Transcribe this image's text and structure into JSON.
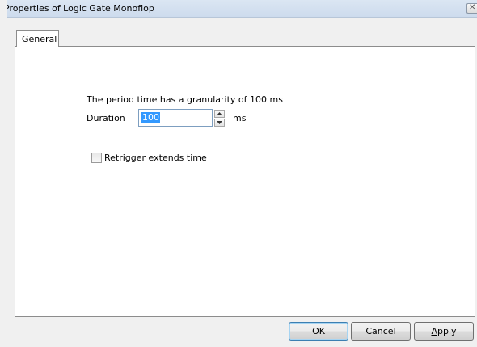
{
  "window": {
    "title": "Properties of Logic Gate Monoflop",
    "close_icon": "close-icon"
  },
  "tabs": [
    {
      "label": "General",
      "active": true
    }
  ],
  "general": {
    "info_text": "The period time has a granularity of 100 ms",
    "duration_label": "Duration",
    "duration_value": "100",
    "duration_unit": "ms",
    "retrigger_label": "Retrigger extends time",
    "retrigger_checked": false
  },
  "buttons": {
    "ok": "OK",
    "cancel": "Cancel",
    "apply_mnemonic": "A",
    "apply_rest": "pply"
  },
  "colors": {
    "selection": "#3399ff",
    "ok_border": "#3c7fb1"
  }
}
